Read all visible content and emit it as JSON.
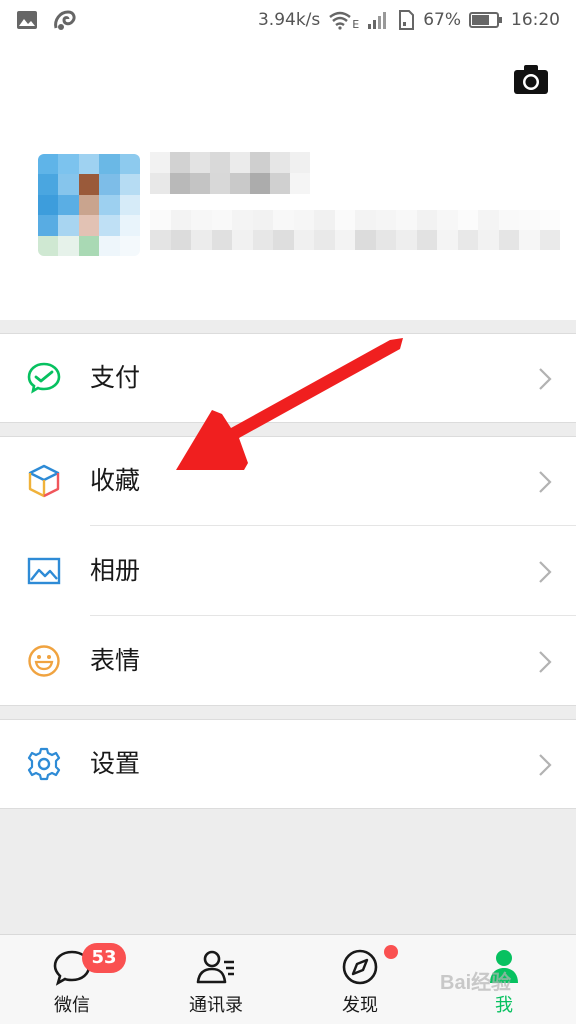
{
  "status_bar": {
    "speed": "3.94k/s",
    "network_type": "E",
    "battery_percent": "67%",
    "time": "16:20",
    "icons": [
      "image-icon",
      "uc-browser-icon",
      "wifi-icon",
      "signal-icon",
      "sim-icon",
      "battery-icon"
    ]
  },
  "profile": {
    "camera_icon": "camera-icon",
    "avatar": "pixelated",
    "name": "",
    "account_id": ""
  },
  "menu": {
    "groups": [
      {
        "items": [
          {
            "label": "支付",
            "icon": "wallet-icon",
            "color": "#07c160"
          }
        ]
      },
      {
        "items": [
          {
            "label": "收藏",
            "icon": "cube-icon",
            "color": "#f0b23a"
          },
          {
            "label": "相册",
            "icon": "photo-icon",
            "color": "#2e8bd6"
          },
          {
            "label": "表情",
            "icon": "smile-icon",
            "color": "#f0a340"
          }
        ]
      },
      {
        "items": [
          {
            "label": "设置",
            "icon": "gear-icon",
            "color": "#2e8bd6"
          }
        ]
      }
    ]
  },
  "tab_bar": {
    "tabs": [
      {
        "label": "微信",
        "icon": "chat-icon",
        "badge": "53"
      },
      {
        "label": "通讯录",
        "icon": "contacts-icon"
      },
      {
        "label": "发现",
        "icon": "compass-icon",
        "dot": true
      },
      {
        "label": "我",
        "icon": "me-icon",
        "active": true
      }
    ]
  },
  "watermark": "Bai经验",
  "colors": {
    "accent": "#07c160",
    "badge": "#fa5151",
    "arrow": "#f01f1f",
    "background": "#ededed"
  }
}
